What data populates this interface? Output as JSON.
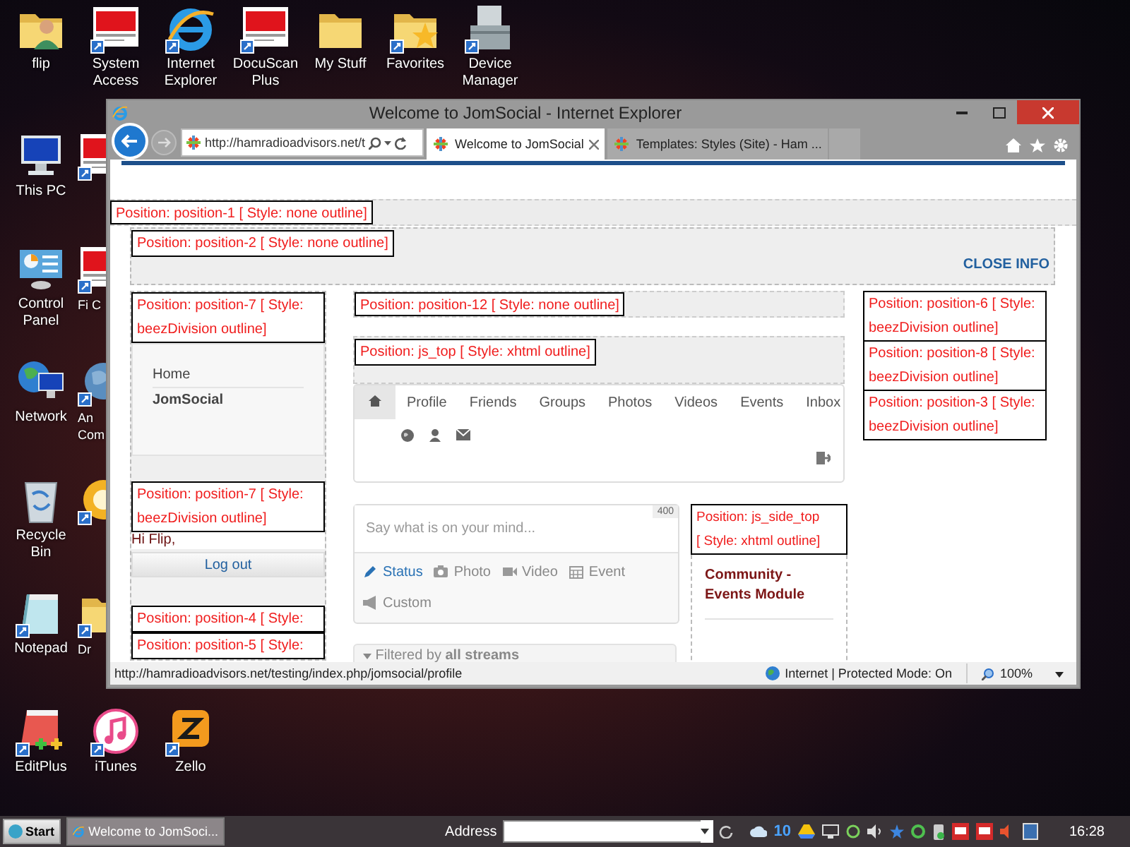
{
  "desktop_icons": [
    {
      "label": "flip",
      "kind": "folder-person",
      "shortcut": false,
      "cut_off": false
    },
    {
      "label": "System Access",
      "kind": "serotex",
      "shortcut": true,
      "cut_off": false
    },
    {
      "label": "Internet Explorer",
      "kind": "ie",
      "shortcut": true,
      "cut_off": false
    },
    {
      "label": "DocuScan Plus",
      "kind": "serotex",
      "shortcut": true,
      "cut_off": false
    },
    {
      "label": "My Stuff",
      "kind": "folder",
      "shortcut": false,
      "cut_off": false
    },
    {
      "label": "Favorites",
      "kind": "folder-star",
      "shortcut": true,
      "cut_off": false
    },
    {
      "label": "Device Manager",
      "kind": "toolbox",
      "shortcut": true,
      "cut_off": false
    },
    {
      "label": "This PC",
      "kind": "monitor",
      "shortcut": false,
      "cut_off": false
    },
    {
      "kind": "serotex",
      "shortcut": true,
      "cut_off": true
    },
    {
      "label": "Control Panel",
      "kind": "control-panel",
      "shortcut": false,
      "cut_off": false
    },
    {
      "label": "Fi C",
      "kind": "serotex",
      "shortcut": true,
      "cut_off": true
    },
    {
      "label": "Network",
      "kind": "globe-monitor",
      "shortcut": false,
      "cut_off": false
    },
    {
      "label": "An Com",
      "kind": "globe",
      "shortcut": true,
      "cut_off": true
    },
    {
      "label": "Recycle Bin",
      "kind": "recycle-bin",
      "shortcut": false,
      "cut_off": false
    },
    {
      "kind": "orb",
      "shortcut": true,
      "cut_off": true
    },
    {
      "label": "Notepad",
      "kind": "notepad",
      "shortcut": true,
      "cut_off": false
    },
    {
      "label": "Dr",
      "kind": "folder",
      "shortcut": true,
      "cut_off": true
    },
    {
      "label": "EditPlus",
      "kind": "editplus",
      "shortcut": true,
      "cut_off": false
    },
    {
      "label": "iTunes",
      "kind": "itunes",
      "shortcut": true,
      "cut_off": false
    },
    {
      "label": "Zello",
      "kind": "zello",
      "shortcut": true,
      "cut_off": false
    }
  ],
  "window": {
    "title": "Welcome to JomSocial - Internet Explorer",
    "address": {
      "value": "http://hamradioadvisors.net/t"
    },
    "tabs": [
      {
        "label": "Welcome to JomSocial",
        "selected": true
      },
      {
        "label": "Templates: Styles (Site) - Ham ...",
        "selected": false
      }
    ],
    "page": {
      "top_label": "Position: position-1 [ Style: none outline]",
      "info": {
        "label": "Position: position-2 [ Style: none outline]",
        "close": "CLOSE INFO"
      },
      "left": {
        "label": "Position: position-7 [ Style: beezDivision outline]",
        "menu": [
          {
            "label": "Home",
            "selected": false
          },
          {
            "label": "JomSocial",
            "selected": true
          }
        ],
        "login_label": "Position: position-7 [ Style: beezDivision outline]",
        "greeting": "Hi Flip,",
        "logout": "Log out",
        "more_labels": [
          "Position: position-4 [ Style:",
          "Position: position-5 [ Style:"
        ]
      },
      "middle": {
        "label": "Position: position-12 [ Style: none outline]",
        "js_top_label": "Position: js_top [ Style: xhtml outline]",
        "nav": [
          {
            "kind": "home",
            "selected": true
          },
          {
            "kind": "text",
            "label": "Profile",
            "selected": false
          },
          {
            "kind": "text",
            "label": "Friends",
            "selected": false
          },
          {
            "kind": "text",
            "label": "Groups",
            "selected": false
          },
          {
            "kind": "text",
            "label": "Photos",
            "selected": false
          },
          {
            "kind": "text",
            "label": "Videos",
            "selected": false
          },
          {
            "kind": "text",
            "label": "Events",
            "selected": false
          },
          {
            "kind": "text",
            "label": "Inbox",
            "selected": false
          }
        ],
        "composer": {
          "placeholder": "Say what is on your mind...",
          "counter": "400",
          "actions": [
            {
              "label": "Status",
              "kind": "pencil",
              "selected": true
            },
            {
              "label": "Photo",
              "kind": "camera",
              "selected": false
            },
            {
              "label": "Video",
              "kind": "video",
              "selected": false
            },
            {
              "label": "Event",
              "kind": "calendar",
              "selected": false
            },
            {
              "label": "Custom",
              "kind": "megaphone",
              "selected": false
            }
          ]
        },
        "filter": "Filtered by **all streams**",
        "side_label": "Position: js_side_top [ Style: xhtml outline]",
        "module_title": "Community - Events Module"
      },
      "right": {
        "labels": [
          "Position: position-6 [ Style: beezDivision outline]",
          "Position: position-8 [ Style: beezDivision outline]",
          "Position: position-3 [ Style: beezDivision outline]"
        ]
      }
    },
    "status_bar": {
      "url": "http://hamradioadvisors.net/testing/index.php/jomsocial/profile",
      "zone": "Internet | Protected Mode: On",
      "zoom": "100%"
    }
  },
  "taskbar": {
    "start": "Start",
    "tasks": [
      {
        "label": "Welcome to JomSoci...",
        "selected": true
      }
    ],
    "address_label": "Address",
    "tray_badge": "10",
    "clock": "16:28"
  }
}
